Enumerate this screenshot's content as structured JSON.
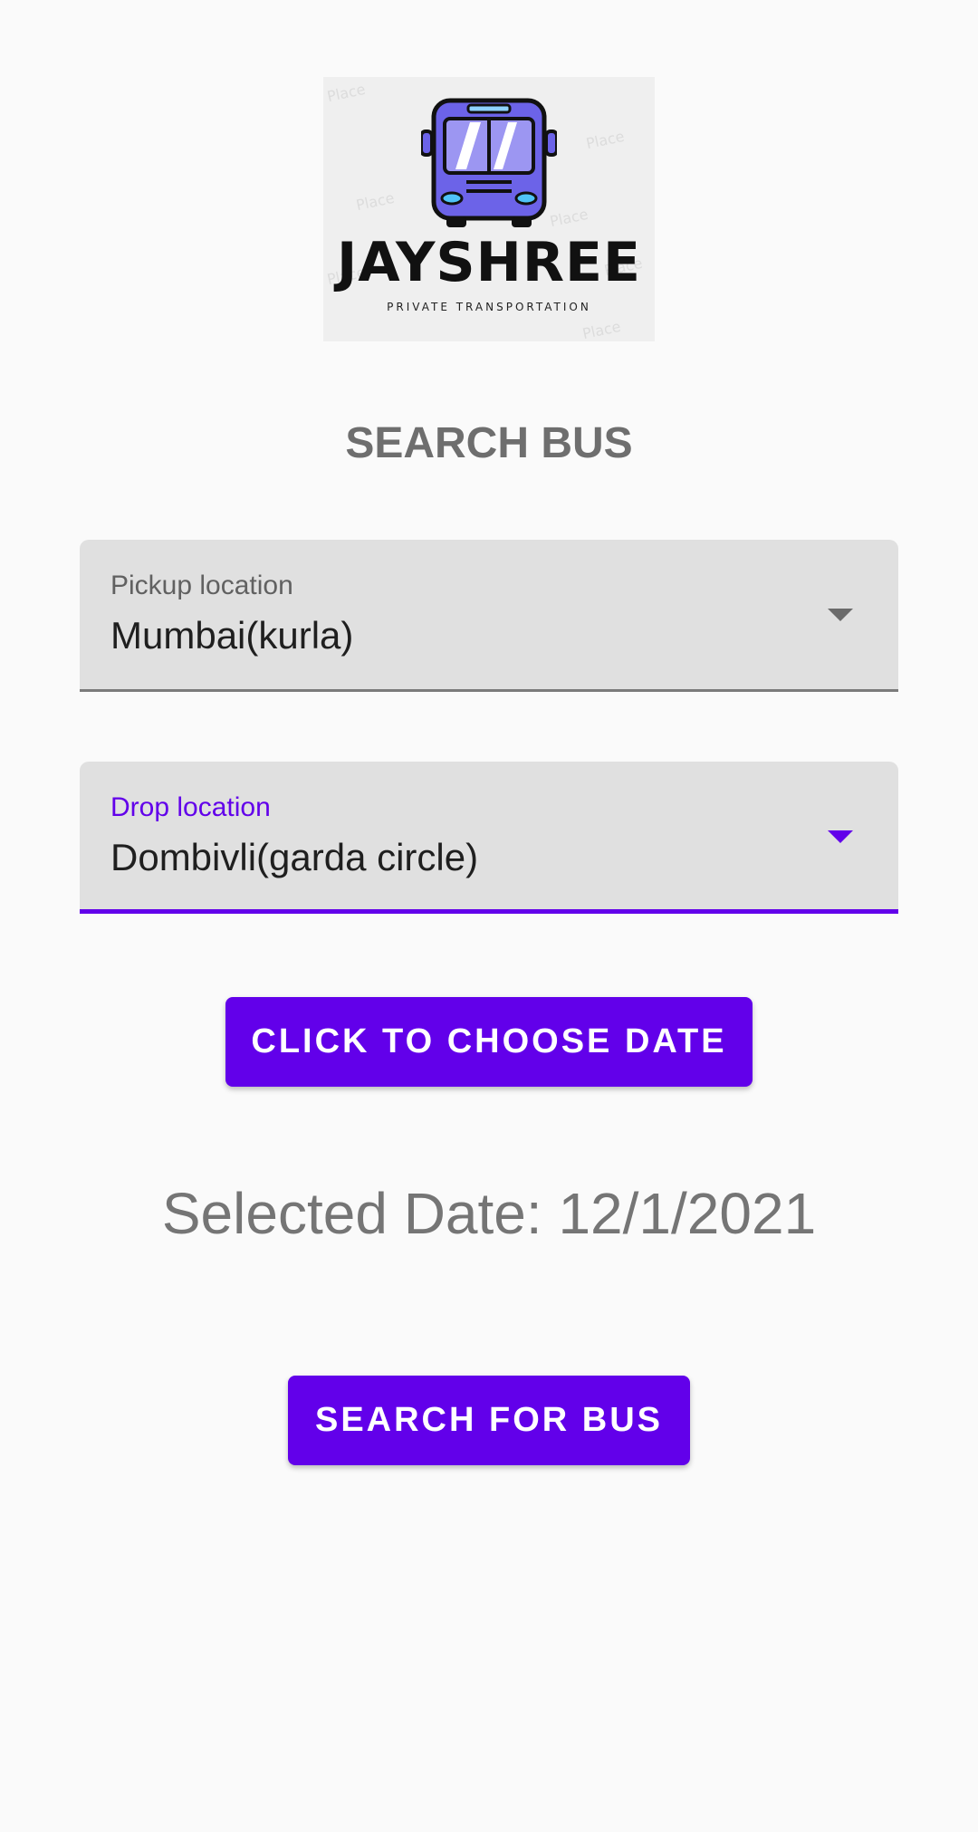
{
  "logo": {
    "brand_name": "JAYSHREE",
    "tagline": "PRIVATE TRANSPORTATION",
    "icon": "bus-icon"
  },
  "page": {
    "title": "SEARCH BUS"
  },
  "pickup": {
    "label": "Pickup location",
    "value": "Mumbai(kurla)"
  },
  "drop": {
    "label": "Drop location",
    "value": "Dombivli(garda circle)"
  },
  "buttons": {
    "choose_date": "CLICK TO CHOOSE DATE",
    "search": "SEARCH FOR BUS"
  },
  "selected_date": {
    "text": "Selected Date: 12/1/2021"
  },
  "colors": {
    "accent": "#6200ea",
    "bus_body": "#6c63e8",
    "field_bg": "#e0e0e0",
    "text_muted": "#757575"
  }
}
